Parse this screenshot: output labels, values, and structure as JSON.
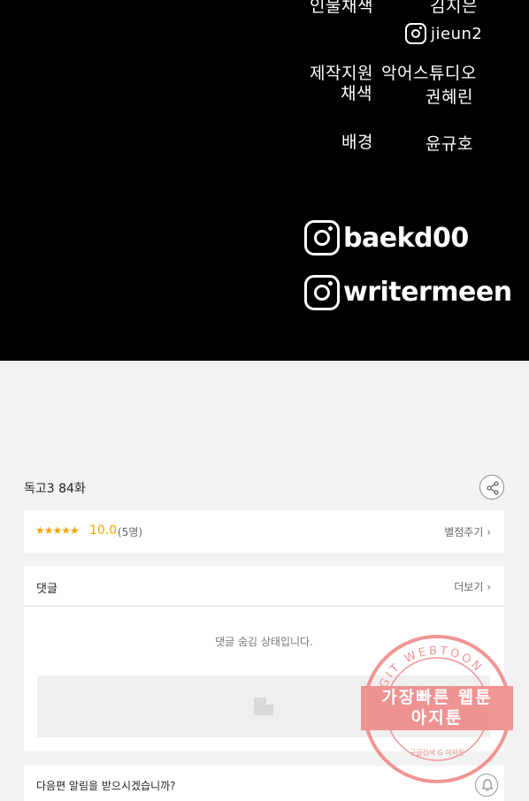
{
  "comic": {
    "credits": [
      {
        "role": "인물채색",
        "name": "김지은"
      },
      {
        "handle_small": "jieun2"
      },
      {
        "role": "제작지원",
        "name": "악어스튜디오"
      },
      {
        "role2": "채색",
        "name2": "권혜린"
      },
      {
        "role": "배경",
        "name": "윤규호"
      }
    ],
    "handles": [
      "baekd00",
      "writermeen"
    ]
  },
  "episode": {
    "title": "독고3 84화"
  },
  "rating": {
    "stars": "★★★★★",
    "score": "10.0",
    "count": "(5명)",
    "rate_label": "별점주기 ›"
  },
  "comments": {
    "title": "댓글",
    "more_label": "더보기 ›",
    "hidden_message": "댓글 숨김 상태입니다."
  },
  "notify": {
    "text": "다음편 알림을 받으시겠습니까?"
  },
  "watermark": {
    "arc": "AGIT WEBTOON",
    "line1": "가장빠른 웹툰",
    "line2": "아지툰",
    "bottom": "구글검색 G 아지툰"
  },
  "colors": {
    "accent": "#f5a300",
    "stamp": "#f08b8b"
  }
}
